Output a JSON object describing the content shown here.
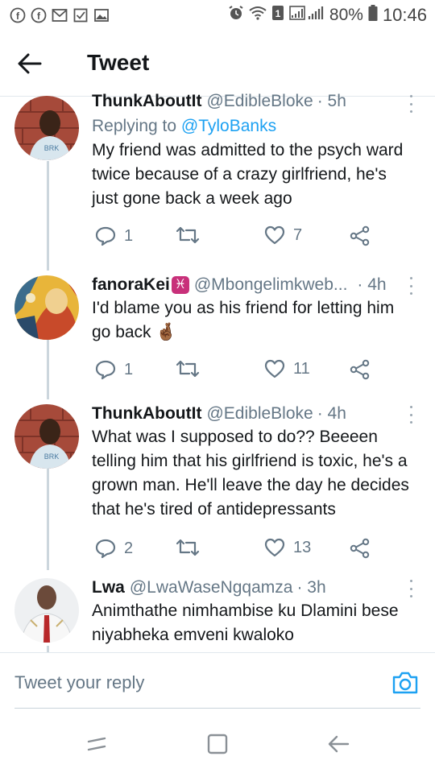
{
  "status_bar": {
    "battery": "80%",
    "time": "10:46",
    "icons": [
      "facebook-icon",
      "facebook-icon",
      "gmail-icon",
      "checkbox-icon",
      "gallery-icon",
      "alarm-icon",
      "wifi-icon",
      "sim-icon",
      "signal-icon",
      "battery-icon"
    ]
  },
  "header": {
    "title": "Tweet"
  },
  "tweets": [
    {
      "name": "ThunkAboutIt",
      "handle": "@EdibleBloke",
      "time": "· 5h",
      "replying_prefix": "Replying to ",
      "replying_to": "@TyloBanks",
      "text": "My friend was admitted to the psych ward twice because of a crazy girlfriend, he's just gone back a week ago",
      "replies": "1",
      "retweets": "",
      "likes": "7"
    },
    {
      "name": "fanoraKei",
      "name_emoji": "♓",
      "handle": "@Mbongelimkweb...",
      "time": "· 4h",
      "text": "I'd blame you as his friend for letting him go back 🤞🏾",
      "replies": "1",
      "retweets": "",
      "likes": "11"
    },
    {
      "name": "ThunkAboutIt",
      "handle": "@EdibleBloke",
      "time": "· 4h",
      "text": "What was I supposed to do?? Beeeen telling him that his girlfriend is toxic, he's a grown man. He'll leave the day he decides that he's tired of antidepressants",
      "replies": "2",
      "retweets": "",
      "likes": "13"
    },
    {
      "name": "Lwa",
      "handle": "@LwaWaseNgqamza",
      "time": "· 3h",
      "text": "Animthathe nimhambise ku Dlamini bese niyabheka emveni kwaloko"
    }
  ],
  "reply_bar": {
    "placeholder": "Tweet your reply"
  },
  "colors": {
    "accent": "#1da1f2",
    "text": "#14171a",
    "muted": "#657786",
    "divider": "#e1e8ed"
  }
}
